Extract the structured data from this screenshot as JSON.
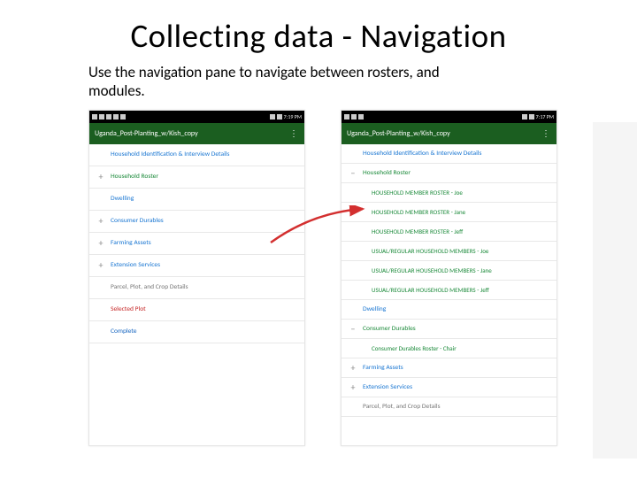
{
  "title": "Collecting data - Navigation",
  "subtitle": "Use the navigation pane to navigate between rosters, and modules.",
  "left_phone": {
    "time": "7:19 PM",
    "app_title": "Uganda_Post-Planting_w/Kish_copy",
    "rows": [
      {
        "kind": "header",
        "icon": "",
        "label": "Household Identification & Interview Details"
      },
      {
        "kind": "section",
        "icon": "+",
        "label": "Household Roster"
      },
      {
        "kind": "plain",
        "icon": "",
        "label": "Dwelling"
      },
      {
        "kind": "plain",
        "icon": "+",
        "label": "Consumer Durables"
      },
      {
        "kind": "plain",
        "icon": "+",
        "label": "Farming Assets"
      },
      {
        "kind": "plain",
        "icon": "+",
        "label": "Extension Services"
      },
      {
        "kind": "muted",
        "icon": "",
        "label": "Parcel, Plot, and Crop Details"
      },
      {
        "kind": "selected",
        "icon": "",
        "label": "Selected Plot"
      },
      {
        "kind": "complete",
        "icon": "",
        "label": "Complete"
      }
    ]
  },
  "right_phone": {
    "time": "7:17 PM",
    "app_title": "Uganda_Post-Planting_w/Kish_copy",
    "rows": [
      {
        "kind": "header",
        "icon": "",
        "label": "Household Identification & Interview Details"
      },
      {
        "kind": "section",
        "icon": "−",
        "label": "Household Roster"
      },
      {
        "kind": "sub",
        "icon": "",
        "label": "HOUSEHOLD MEMBER ROSTER - Joe"
      },
      {
        "kind": "sub",
        "icon": "",
        "label": "HOUSEHOLD MEMBER ROSTER - Jane"
      },
      {
        "kind": "sub",
        "icon": "",
        "label": "HOUSEHOLD MEMBER ROSTER - Jeff"
      },
      {
        "kind": "sub",
        "icon": "",
        "label": "USUAL/REGULAR  HOUSEHOLD MEMBERS - Joe"
      },
      {
        "kind": "sub",
        "icon": "",
        "label": "USUAL/REGULAR  HOUSEHOLD MEMBERS - Jane"
      },
      {
        "kind": "sub",
        "icon": "",
        "label": "USUAL/REGULAR  HOUSEHOLD MEMBERS - Jeff"
      },
      {
        "kind": "plain",
        "icon": "",
        "label": "Dwelling"
      },
      {
        "kind": "section",
        "icon": "−",
        "label": "Consumer Durables"
      },
      {
        "kind": "sub",
        "icon": "",
        "label": "Consumer Durables Roster - Chair"
      },
      {
        "kind": "plain",
        "icon": "+",
        "label": "Farming Assets"
      },
      {
        "kind": "plain",
        "icon": "+",
        "label": "Extension Services"
      },
      {
        "kind": "muted",
        "icon": "",
        "label": "Parcel, Plot, and Crop Details"
      }
    ]
  }
}
